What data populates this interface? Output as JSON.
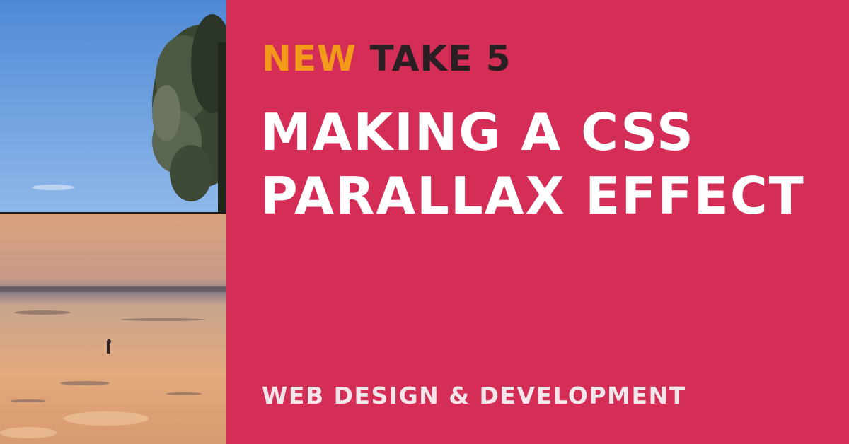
{
  "colors": {
    "panel_background": "#d42e56",
    "accent": "#f39a1b",
    "dark_text": "#2a1f22",
    "headline_text": "#ffffff"
  },
  "kicker": {
    "new_label": "NEW",
    "take_label": "TAKE 5"
  },
  "headline": {
    "line1": "MAKING A CSS",
    "line2": "PARALLAX EFFECT"
  },
  "category": "WEB DESIGN & DEVELOPMENT"
}
